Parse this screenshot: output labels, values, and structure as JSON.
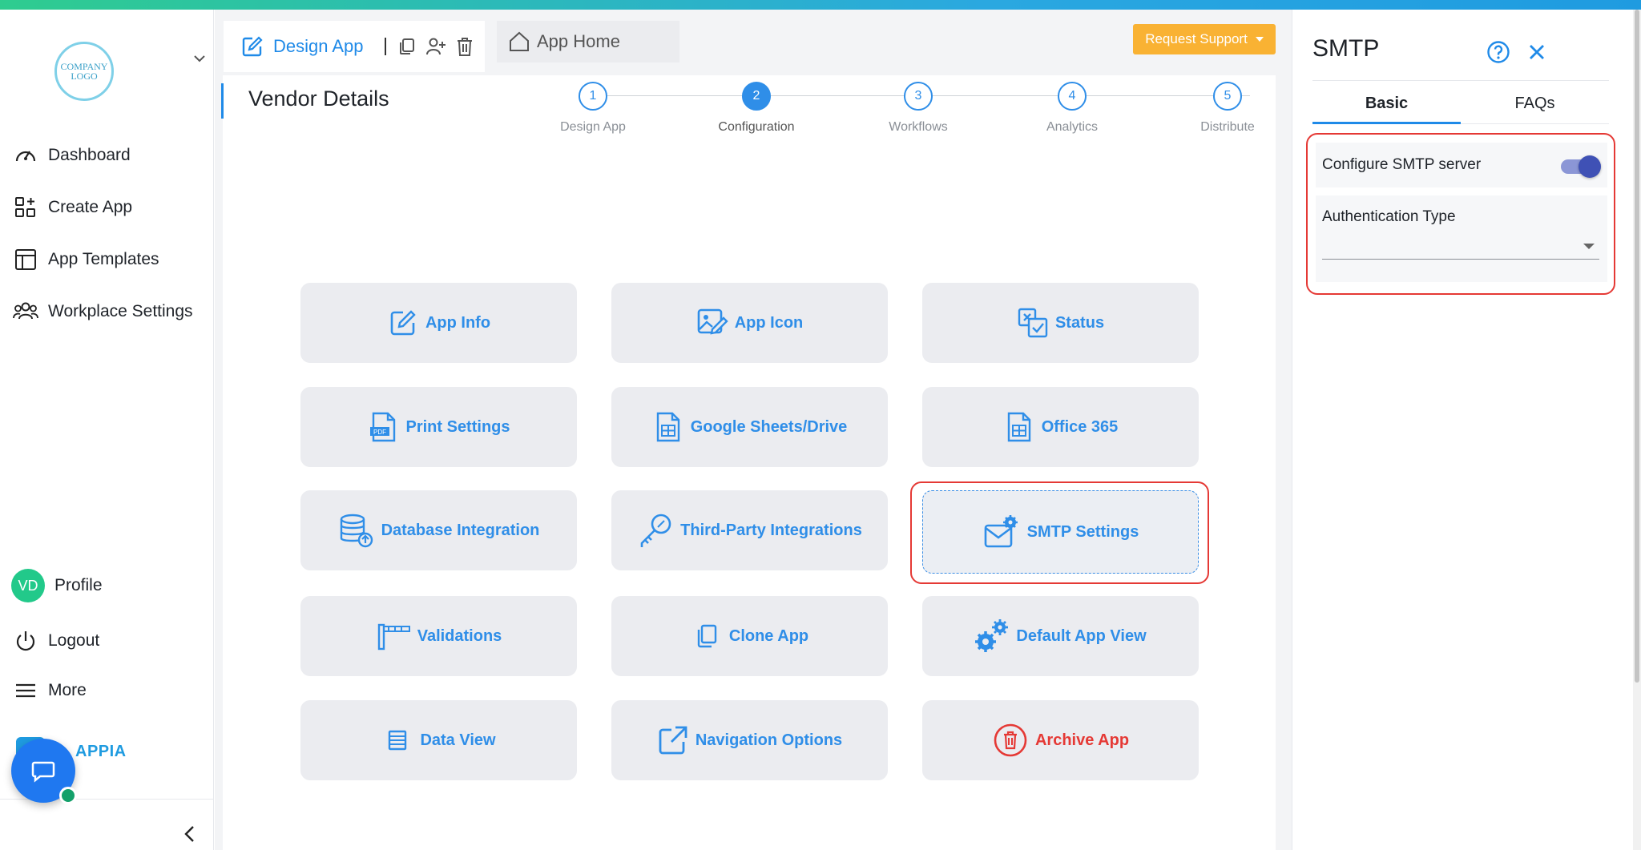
{
  "sidebar": {
    "logo_text": "COMPANY LOGO",
    "nav": [
      {
        "label": "Dashboard",
        "icon": "gauge-icon"
      },
      {
        "label": "Create App",
        "icon": "grid-plus-icon"
      },
      {
        "label": "App Templates",
        "icon": "layout-icon"
      },
      {
        "label": "Workplace Settings",
        "icon": "users-icon"
      }
    ],
    "profile": {
      "initials": "VD",
      "label": "Profile"
    },
    "logout_label": "Logout",
    "more_label": "More",
    "brand_text": "APPIA"
  },
  "tabs": {
    "design_label": "Design App",
    "home_label": "App Home"
  },
  "toolbar": {
    "support_label": "Request Support"
  },
  "page": {
    "title": "Vendor Details"
  },
  "stepper": [
    {
      "num": "1",
      "label": "Design App",
      "active": false
    },
    {
      "num": "2",
      "label": "Configuration",
      "active": true
    },
    {
      "num": "3",
      "label": "Workflows",
      "active": false
    },
    {
      "num": "4",
      "label": "Analytics",
      "active": false
    },
    {
      "num": "5",
      "label": "Distribute",
      "active": false
    }
  ],
  "cards": [
    {
      "label": "App Info",
      "icon": "edit-icon"
    },
    {
      "label": "App Icon",
      "icon": "image-edit-icon"
    },
    {
      "label": "Status",
      "icon": "status-icon"
    },
    {
      "label": "Print Settings",
      "icon": "pdf-icon"
    },
    {
      "label": "Google Sheets/Drive",
      "icon": "sheet-icon"
    },
    {
      "label": "Office 365",
      "icon": "sheet-icon"
    },
    {
      "label": "Database Integration",
      "icon": "database-icon"
    },
    {
      "label": "Third-Party Integrations",
      "icon": "key-icon"
    },
    {
      "label": "SMTP Settings",
      "icon": "mail-gear-icon"
    },
    {
      "label": "Validations",
      "icon": "barrier-icon"
    },
    {
      "label": "Clone App",
      "icon": "copy-icon"
    },
    {
      "label": "Default App View",
      "icon": "gears-icon"
    },
    {
      "label": "Data View",
      "icon": "list-icon"
    },
    {
      "label": "Navigation Options",
      "icon": "external-link-icon"
    },
    {
      "label": "Archive App",
      "icon": "trash-circle-icon"
    }
  ],
  "panel": {
    "title": "SMTP",
    "tabs": [
      "Basic",
      "FAQs"
    ],
    "configure_label": "Configure SMTP server",
    "configure_enabled": true,
    "auth_label": "Authentication Type",
    "auth_value": ""
  },
  "colors": {
    "primary": "#2f8ee8",
    "danger": "#e53935",
    "warning": "#f9b233",
    "toggle": "#3f51b5"
  }
}
